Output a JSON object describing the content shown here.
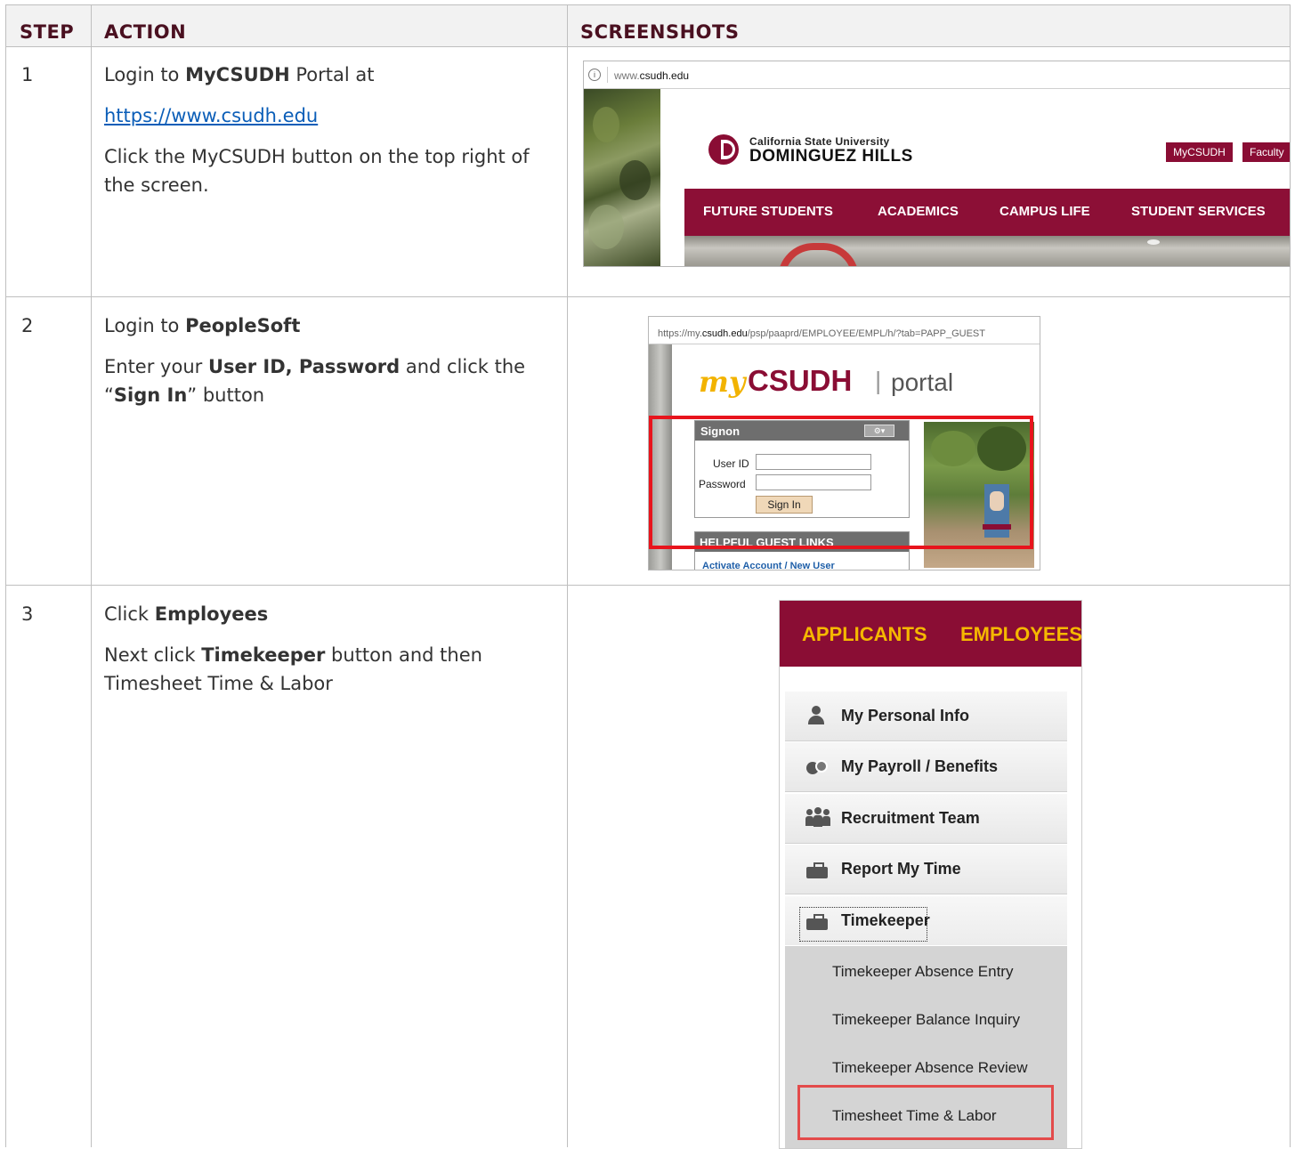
{
  "table": {
    "headers": {
      "step": "STEP",
      "action": "ACTION",
      "screenshots": "SCREENSHOTS"
    },
    "rows": [
      {
        "step": "1",
        "line1_a": "Login to ",
        "line1_b": "MyCSUDH",
        "line1_c": " Portal at",
        "link": "https://www.csudh.edu",
        "line3": "Click the MyCSUDH button on the top right of the screen."
      },
      {
        "step": "2",
        "line1_a": "Login to ",
        "line1_b": "PeopleSoft",
        "line2_a": "Enter your ",
        "line2_b": "User ID, Password",
        "line2_c": " and click the",
        "line3_a": "“",
        "line3_b": "Sign In",
        "line3_c": "” button"
      },
      {
        "step": "3",
        "line1_a": "Click ",
        "line1_b": "Employees",
        "line2_a": "Next click ",
        "line2_b": "Timekeeper",
        "line2_c": " button and then",
        "line3": "Timesheet Time & Labor"
      }
    ]
  },
  "shot1": {
    "url_prefix": "www.",
    "url_domain": "csudh.edu",
    "logo_line1": "California State University",
    "logo_line2": "DOMINGUEZ HILLS",
    "btn_mycsudh": "MyCSUDH",
    "btn_faculty": "Faculty",
    "nav": [
      "FUTURE STUDENTS",
      "ACADEMICS",
      "CAMPUS LIFE",
      "STUDENT SERVICES"
    ],
    "colors": {
      "maroon": "#8a0d34",
      "nav": "#8c0f36"
    }
  },
  "shot2": {
    "url_a": "https://my.",
    "url_b": "csudh.edu",
    "url_c": "/psp/paaprd/EMPLOYEE/EMPL/h/?tab=PAPP_GUEST",
    "logo_my": "my",
    "logo_csudh": "CSUDH",
    "logo_sep": "|",
    "logo_portal": "portal",
    "signon": "Signon",
    "user_id_label": "User ID",
    "password_label": "Password",
    "sign_in": "Sign In",
    "guest_links": "HELPFUL GUEST LINKS",
    "activate": "Activate Account / New User"
  },
  "shot3": {
    "tab_applicants": "APPLICANTS",
    "tab_employees": "EMPLOYEES",
    "menu": [
      {
        "label": "My Personal Info",
        "icon": "person-icon"
      },
      {
        "label": "My Payroll / Benefits",
        "icon": "payroll-icon"
      },
      {
        "label": "Recruitment Team",
        "icon": "team-icon"
      },
      {
        "label": "Report My Time",
        "icon": "briefcase-icon"
      },
      {
        "label": "Timekeeper",
        "icon": "briefcase-icon"
      }
    ],
    "submenu": [
      "Timekeeper Absence Entry",
      "Timekeeper Balance Inquiry",
      "Timekeeper Absence Review",
      "Timesheet Time & Labor"
    ]
  }
}
